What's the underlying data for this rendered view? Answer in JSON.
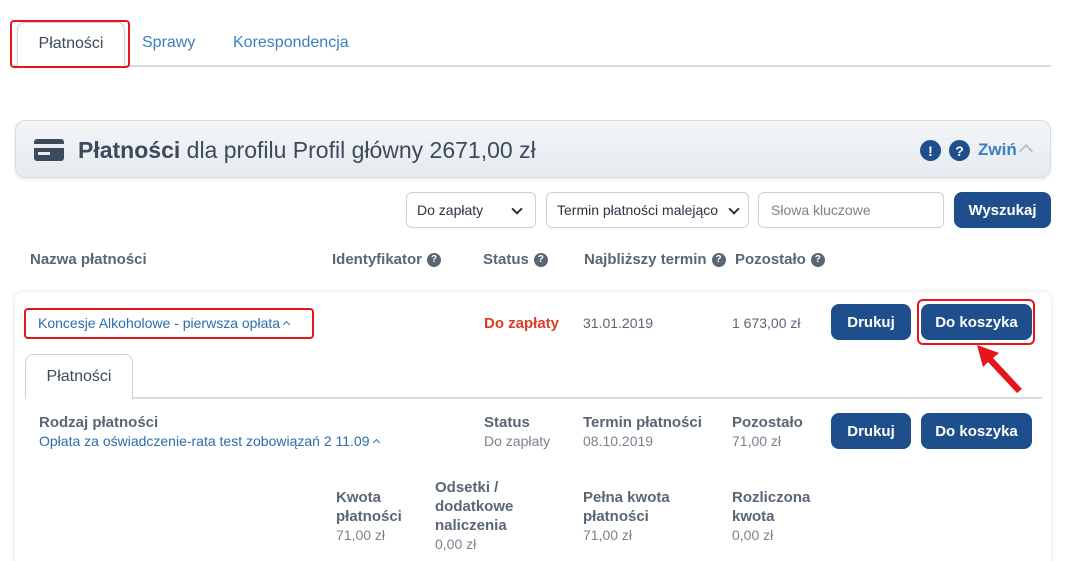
{
  "tabs": [
    "Płatności",
    "Sprawy",
    "Korespondencja"
  ],
  "header": {
    "title_bold": "Płatności",
    "title_rest": "dla profilu Profil główny 2671,00 zł",
    "collapse_label": "Zwiń"
  },
  "filters": {
    "status_select": "Do zapłaty",
    "sort_select": "Termin płatności malejąco",
    "keywords_placeholder": "Słowa kluczowe",
    "search_button": "Wyszukaj"
  },
  "columns": [
    "Nazwa płatności",
    "Identyfikator",
    "Status",
    "Najbliższy termin",
    "Pozostało"
  ],
  "payment": {
    "name": "Koncesje Alkoholowe - pierwsza opłata",
    "status": "Do zapłaty",
    "date": "31.01.2019",
    "remaining": "1 673,00 zł",
    "print_button": "Drukuj",
    "cart_button": "Do koszyka"
  },
  "details": {
    "tab": "Płatności",
    "type_label": "Rodzaj płatności",
    "type_value": "Opłata za oświadczenie-rata test zobowiązań 2 11.09",
    "status_label": "Status",
    "status_value": "Do zapłaty",
    "due_label": "Termin płatności",
    "due_value": "08.10.2019",
    "remaining_label": "Pozostało",
    "remaining_value": "71,00 zł",
    "print_button": "Drukuj",
    "cart_button": "Do koszyka",
    "amounts": [
      {
        "label": "Kwota płatności",
        "value": "71,00 zł"
      },
      {
        "label": "Odsetki / dodatkowe naliczenia",
        "value": "0,00 zł"
      },
      {
        "label": "Pełna kwota płatności",
        "value": "71,00 zł"
      },
      {
        "label": "Rozliczona kwota",
        "value": "0,00 zł"
      }
    ]
  },
  "colors": {
    "primary": "#1f4e8c",
    "link": "#2a6db0",
    "alert": "#e03b24",
    "highlight": "#e8141c"
  }
}
